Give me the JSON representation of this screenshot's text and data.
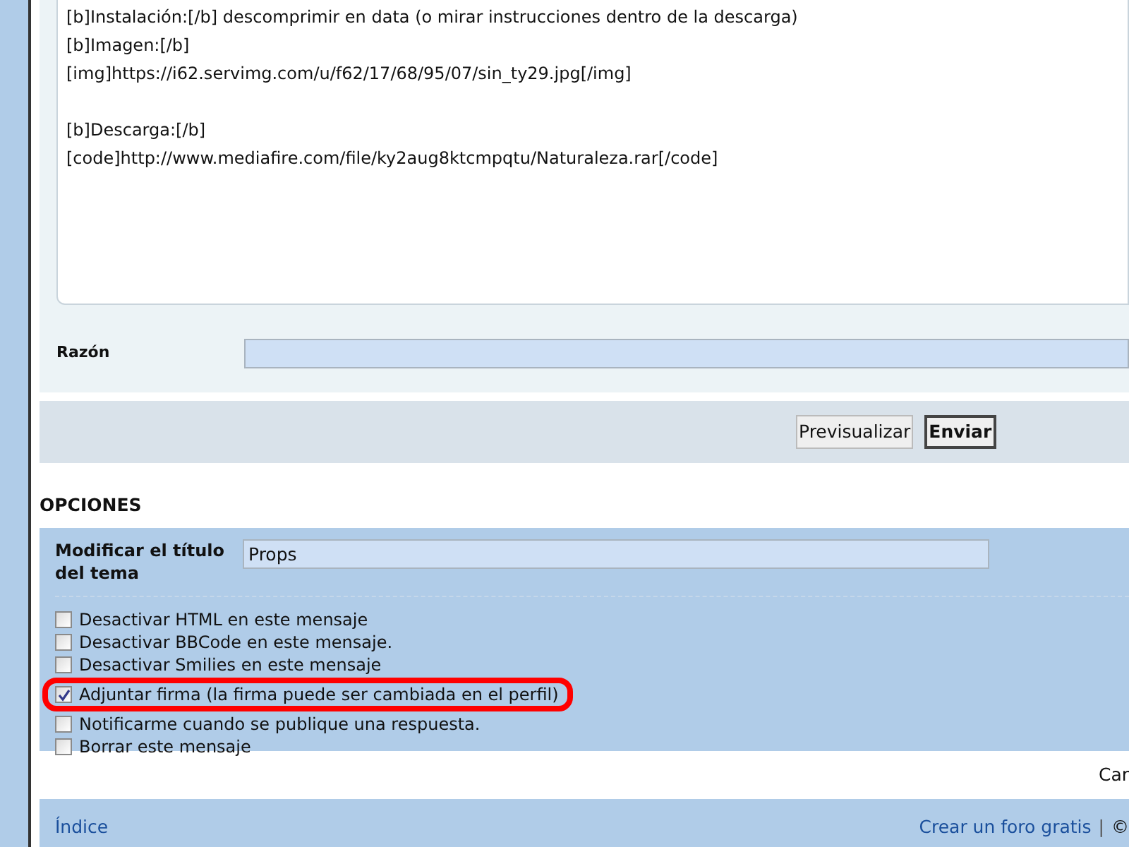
{
  "editor": {
    "lines": [
      "[b]Instalación:[/b] descomprimir en data (o mirar instrucciones dentro de la descarga)",
      "[b]Imagen:[/b]",
      "[img]https://i62.servimg.com/u/f62/17/68/95/07/sin_ty29.jpg[/img]",
      "[b]Descarga:[/b]",
      "[code]http://www.mediafire.com/file/ky2aug8ktcmpqtu/Naturaleza.rar[/code]"
    ]
  },
  "reason": {
    "label": "Razón"
  },
  "buttons": [
    {
      "label": "Previsualizar",
      "kind": "preview"
    },
    {
      "label": "Enviar",
      "kind": "submit"
    }
  ],
  "options": {
    "heading": "OPCIONES",
    "title_label": "Modificar el título del tema",
    "title_value": "Props",
    "checkboxes": [
      {
        "label": "Desactivar HTML en este mensaje",
        "checked": false,
        "highlighted": false
      },
      {
        "label": "Desactivar BBCode en este mensaje.",
        "checked": false,
        "highlighted": false
      },
      {
        "label": "Desactivar Smilies en este mensaje",
        "checked": false,
        "highlighted": false
      },
      {
        "label": "Adjuntar firma (la firma puede ser cambiada en el perfil)",
        "checked": true,
        "highlighted": true
      },
      {
        "label": "Notificarme cuando se publique una respuesta.",
        "checked": false,
        "highlighted": false
      },
      {
        "label": "Borrar este mensaje",
        "checked": false,
        "highlighted": false
      }
    ]
  },
  "cut_text": "Car",
  "footer": {
    "left_link": "Índice",
    "right_link": "Crear un foro gratis",
    "separator": "|",
    "copyright": "©"
  }
}
